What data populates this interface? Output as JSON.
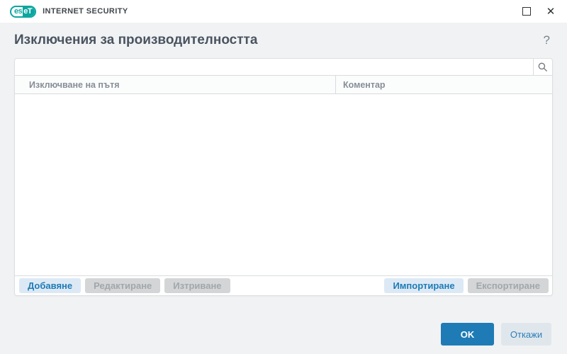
{
  "titlebar": {
    "logo": {
      "icon": "eset-logo",
      "text_left": "es",
      "text_right": "eT"
    },
    "brand": "INTERNET SECURITY",
    "controls": {
      "maximize_icon": "square-outline",
      "close_icon": "✕"
    }
  },
  "header": {
    "title": "Изключения за производителността",
    "help_icon": "?"
  },
  "search": {
    "value": "",
    "placeholder": "",
    "icon": "magnifier"
  },
  "table": {
    "columns": [
      "Изключване на пътя",
      "Коментар"
    ],
    "rows": []
  },
  "actions": {
    "add": {
      "label": "Добавяне",
      "enabled": true
    },
    "edit": {
      "label": "Редактиране",
      "enabled": false
    },
    "delete": {
      "label": "Изтриване",
      "enabled": false
    },
    "import": {
      "label": "Импортиране",
      "enabled": true
    },
    "export": {
      "label": "Експортиране",
      "enabled": false
    }
  },
  "footer": {
    "ok": "OK",
    "cancel": "Откажи"
  },
  "colors": {
    "accent_blue": "#1e7bb5",
    "light_blue_button": "#dce9f5",
    "disabled_gray": "#d3d5d6",
    "eset_teal": "#0ba6a0",
    "page_background": "#f1f2f4",
    "title_text": "#4a5460"
  }
}
